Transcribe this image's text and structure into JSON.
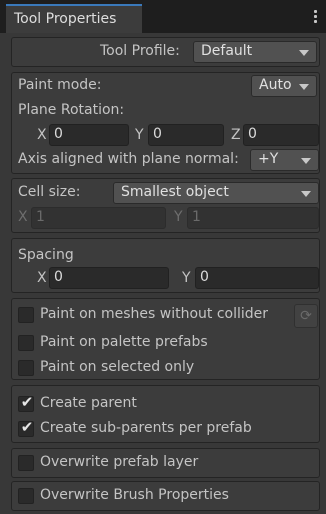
{
  "window": {
    "tab_title": "Tool Properties"
  },
  "tool_profile": {
    "label": "Tool Profile:",
    "value": "Default"
  },
  "paint": {
    "mode_label": "Paint mode:",
    "mode_value": "Auto",
    "plane_rotation_label": "Plane Rotation:",
    "rot_x_label": "X",
    "rot_x": "0",
    "rot_y_label": "Y",
    "rot_y": "0",
    "rot_z_label": "Z",
    "rot_z": "0",
    "axis_label": "Axis aligned with plane normal:",
    "axis_value": "+Y"
  },
  "cell": {
    "label": "Cell size:",
    "value": "Smallest object",
    "x_label": "X",
    "x": "1",
    "y_label": "Y",
    "y": "1"
  },
  "spacing": {
    "label": "Spacing",
    "x_label": "X",
    "x": "0",
    "y_label": "Y",
    "y": "0"
  },
  "options": {
    "paint_meshes": {
      "label": "Paint on meshes without collider",
      "checked": false
    },
    "palette_prefabs": {
      "label": "Paint on palette prefabs",
      "checked": false
    },
    "selected_only": {
      "label": "Paint on selected only",
      "checked": false
    },
    "create_parent": {
      "label": "Create parent",
      "checked": true
    },
    "sub_parents": {
      "label": "Create sub-parents per prefab",
      "checked": true
    },
    "overwrite_layer": {
      "label": "Overwrite prefab layer",
      "checked": false
    },
    "overwrite_brush": {
      "label": "Overwrite Brush Properties",
      "checked": false
    }
  },
  "icons": {
    "check": "✔",
    "refresh": "⟳",
    "kebab": "kebab-menu-icon"
  }
}
